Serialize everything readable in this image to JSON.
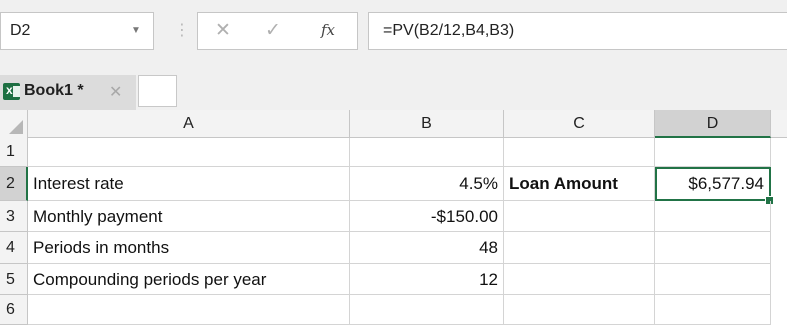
{
  "formula_bar": {
    "name_box": "D2",
    "cancel_glyph": "✕",
    "enter_glyph": "✓",
    "fx_label": "fx",
    "formula": "=PV(B2/12,B4,B3)"
  },
  "workbook_tab": {
    "name": "Book1 *",
    "close_glyph": "✕",
    "icon": "excel-icon"
  },
  "columns": [
    {
      "label": "A",
      "selected": false
    },
    {
      "label": "B",
      "selected": false
    },
    {
      "label": "C",
      "selected": false
    },
    {
      "label": "D",
      "selected": true
    }
  ],
  "rows": [
    {
      "num": "1",
      "A": "",
      "B": "",
      "C": "",
      "D": ""
    },
    {
      "num": "2",
      "A": "Interest rate",
      "B": "4.5%",
      "C": "Loan Amount",
      "D": "$6,577.94"
    },
    {
      "num": "3",
      "A": "Monthly payment",
      "B": "-$150.00",
      "C": "",
      "D": ""
    },
    {
      "num": "4",
      "A": "Periods in months",
      "B": "48",
      "C": "",
      "D": ""
    },
    {
      "num": "5",
      "A": "Compounding periods per year",
      "B": "12",
      "C": "",
      "D": ""
    },
    {
      "num": "6",
      "A": "",
      "B": "",
      "C": "",
      "D": ""
    }
  ],
  "colors": {
    "selection": "#217346",
    "header_bg": "#f3f3f3",
    "selected_header_bg": "#d2d2d2"
  }
}
